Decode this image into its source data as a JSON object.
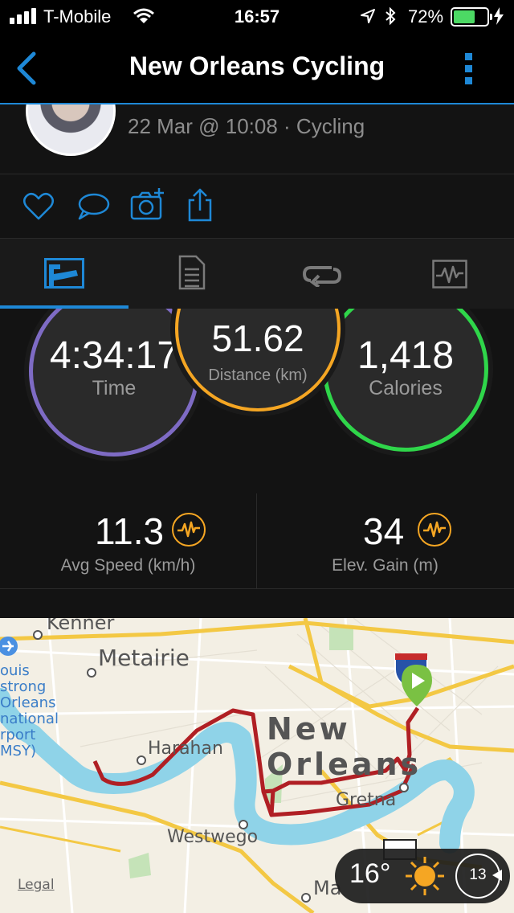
{
  "status_bar": {
    "carrier": "T-Mobile",
    "time": "16:57",
    "battery_percent": "72%",
    "battery_level": 0.72,
    "battery_color": "#4cd964"
  },
  "nav": {
    "title": "New Orleans Cycling",
    "back_icon": "chevron-left-icon",
    "menu_icon": "vertical-dots-icon",
    "accent": "#1e88d6"
  },
  "activity": {
    "meta": "22 Mar @ 10:08 · Cycling"
  },
  "actions": [
    "heart-icon",
    "comment-icon",
    "add-photo-icon",
    "share-icon"
  ],
  "tabs": [
    {
      "icon": "summary-stats-icon",
      "active": true
    },
    {
      "icon": "details-list-icon",
      "active": false
    },
    {
      "icon": "laps-loop-icon",
      "active": false
    },
    {
      "icon": "charts-icon",
      "active": false
    }
  ],
  "stats": {
    "time": {
      "value": "4:34:17",
      "label": "Time",
      "color": "#7e6bc4"
    },
    "distance": {
      "value": "51.62",
      "label": "Distance (km)",
      "color": "#f5a623"
    },
    "calories": {
      "value": "1,418",
      "label": "Calories",
      "color": "#2fd64a"
    }
  },
  "metrics": [
    {
      "value": "11.3",
      "label": "Avg Speed (km/h)",
      "icon": "pulse-icon"
    },
    {
      "value": "34",
      "label": "Elev. Gain (m)",
      "icon": "pulse-icon"
    }
  ],
  "map": {
    "labels": {
      "kenner": "Kenner",
      "metairie": "Metairie",
      "new_orleans": "New Orleans",
      "harahan": "Harahan",
      "gretna": "Gretna",
      "westwego": "Westwego",
      "airport_1": "ouis",
      "airport_2": "strong",
      "airport_3": "Orleans",
      "airport_4": "national",
      "airport_5": "rport",
      "airport_6": "MSY)",
      "ma": "Ma",
      "legal": "Legal"
    },
    "route_color": "#b01f24",
    "river_color": "#8fd3e8"
  },
  "weather": {
    "temperature": "16°",
    "icon": "sun-icon",
    "wind": "13"
  }
}
